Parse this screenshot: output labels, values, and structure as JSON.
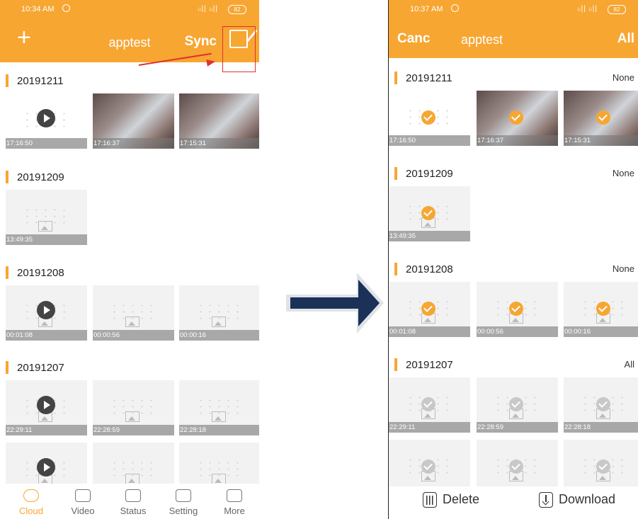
{
  "left": {
    "status": {
      "time": "10:34 AM",
      "signal": "ᵢᵢ|| ᵢᵢ||",
      "battery": "82"
    },
    "header": {
      "title": "apptest",
      "sync": "Sync"
    },
    "sections": [
      {
        "date": "20191211",
        "items": [
          {
            "time": "17:16:50",
            "kind": "blank",
            "play": true
          },
          {
            "time": "17:16:37",
            "kind": "photo",
            "play": false
          },
          {
            "time": "17:15:31",
            "kind": "photo",
            "play": false
          }
        ]
      },
      {
        "date": "20191209",
        "items": [
          {
            "time": "13:49:35",
            "kind": "placeholder",
            "play": false
          }
        ]
      },
      {
        "date": "20191208",
        "items": [
          {
            "time": "00:01:08",
            "kind": "placeholder",
            "play": true
          },
          {
            "time": "00:00:56",
            "kind": "placeholder",
            "play": false
          },
          {
            "time": "00:00:16",
            "kind": "placeholder",
            "play": false
          }
        ]
      },
      {
        "date": "20191207",
        "items": [
          {
            "time": "22:29:11",
            "kind": "placeholder",
            "play": true
          },
          {
            "time": "22:28:59",
            "kind": "placeholder",
            "play": false
          },
          {
            "time": "22:28:18",
            "kind": "placeholder",
            "play": false
          }
        ]
      }
    ],
    "tabs": [
      {
        "label": "Cloud",
        "icon": "cloud-icon",
        "active": true
      },
      {
        "label": "Video",
        "icon": "video-icon",
        "active": false
      },
      {
        "label": "Status",
        "icon": "status-icon",
        "active": false
      },
      {
        "label": "Setting",
        "icon": "gear-icon",
        "active": false
      },
      {
        "label": "More",
        "icon": "grid-icon",
        "active": false
      }
    ]
  },
  "right": {
    "status": {
      "time": "10:37 AM",
      "signal": "ᵢᵢ|| ᵢᵢ||",
      "battery": "82"
    },
    "header": {
      "cancel": "Canc",
      "title": "apptest",
      "all": "All"
    },
    "sections": [
      {
        "date": "20191211",
        "select": "None",
        "items": [
          {
            "time": "17:16:50",
            "kind": "blank",
            "check": "orange"
          },
          {
            "time": "17:16:37",
            "kind": "photo",
            "check": "orange"
          },
          {
            "time": "17:15:31",
            "kind": "photo",
            "check": "orange"
          }
        ]
      },
      {
        "date": "20191209",
        "select": "None",
        "items": [
          {
            "time": "13:49:35",
            "kind": "placeholder",
            "check": "orange"
          }
        ]
      },
      {
        "date": "20191208",
        "select": "None",
        "items": [
          {
            "time": "00:01:08",
            "kind": "placeholder",
            "check": "orange"
          },
          {
            "time": "00:00:56",
            "kind": "placeholder",
            "check": "orange"
          },
          {
            "time": "00:00:16",
            "kind": "placeholder",
            "check": "orange"
          }
        ]
      },
      {
        "date": "20191207",
        "select": "All",
        "items": [
          {
            "time": "22:29:11",
            "kind": "placeholder",
            "check": "grey"
          },
          {
            "time": "22:28:59",
            "kind": "placeholder",
            "check": "grey"
          },
          {
            "time": "22:28:18",
            "kind": "placeholder",
            "check": "grey"
          }
        ]
      }
    ],
    "actions": {
      "delete": "Delete",
      "download": "Download"
    }
  },
  "colors": {
    "accent": "#f7a632",
    "highlight": "#e03030",
    "arrow": "#1b3157"
  }
}
